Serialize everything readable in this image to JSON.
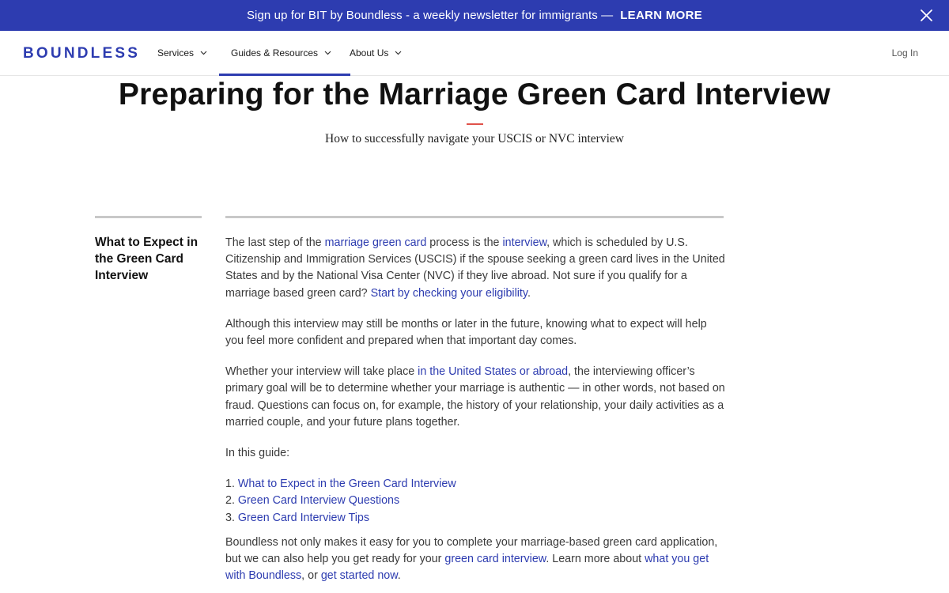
{
  "banner": {
    "message": "Sign up for BIT by Boundless - a weekly newsletter for immigrants —",
    "cta": "LEARN MORE"
  },
  "nav": {
    "logo": "BOUNDLESS",
    "items": [
      {
        "label": "Services"
      },
      {
        "label": "Guides & Resources"
      },
      {
        "label": "About Us"
      }
    ],
    "login": "Log In"
  },
  "hero": {
    "title": "Preparing for the Marriage Green Card Interview",
    "subtitle": "How to successfully navigate your USCIS or NVC interview"
  },
  "sidebar": {
    "title": "What to Expect in the Green Card Interview"
  },
  "content": {
    "p1": {
      "t1": "The last step of the ",
      "l1": "marriage green card",
      "t2": " process is the ",
      "l2": "interview",
      "t3": ", which is scheduled by U.S. Citizenship and Immigration Services (USCIS) if the spouse seeking a green card lives in the United States and by the National Visa Center (NVC) if they live abroad. Not sure if you qualify for a marriage based green card? ",
      "l3": "Start by checking your eligibility",
      "t4": "."
    },
    "p2": "Although this interview may still be months or later in the future, knowing what to expect will help you feel more confident and prepared when that important day comes.",
    "p3": {
      "t1": "Whether your interview will take place ",
      "l1": "in the United States or abroad",
      "t2": ", the interviewing officer’s primary goal will be to determine whether your marriage is authentic — in other words, not based on fraud. Questions can focus on, for example, the history of your relationship, your daily activities as a married couple, and your future plans together."
    },
    "guide_intro": "In this guide:",
    "guide": [
      {
        "num": "1.",
        "label": "What to Expect in the Green Card Interview"
      },
      {
        "num": "2.",
        "label": "Green Card Interview Questions"
      },
      {
        "num": "3.",
        "label": "Green Card Interview Tips"
      }
    ],
    "p4": {
      "t1": "Boundless not only makes it easy for you to complete your marriage-based green card application, but we can also help you get ready for your ",
      "l1": "green card interview",
      "t2": ". Learn more about ",
      "l2": "what you get with Boundless",
      "t3": ", or ",
      "l3": "get started now",
      "t4": "."
    }
  },
  "colors": {
    "brand": "#2d3cb0",
    "accent_rule": "#e0524a",
    "divider": "#c8c8c8"
  }
}
